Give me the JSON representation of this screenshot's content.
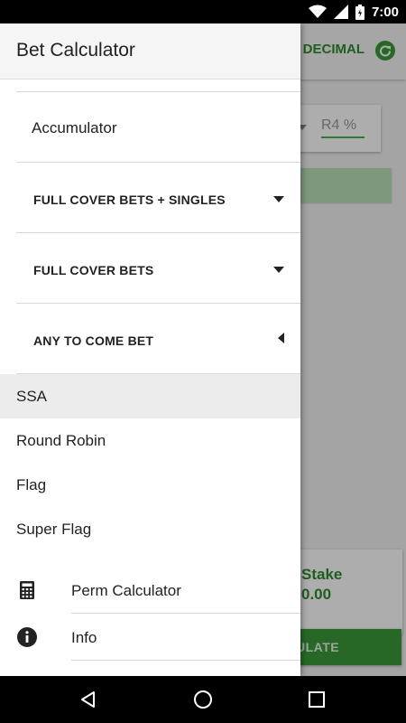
{
  "status_bar": {
    "time": "7:00"
  },
  "background_app": {
    "odds_format": "DECIMAL",
    "rule4_placeholder": "R4 %",
    "total_stake_label": "Stake",
    "total_stake_value": "0.00",
    "calculate_label": "ULATE",
    "accent_color": "#3a9a3a"
  },
  "drawer": {
    "title": "Bet Calculator",
    "accumulator": "Accumulator",
    "groups": [
      {
        "label": "FULL COVER BETS + SINGLES",
        "state": "collapsed"
      },
      {
        "label": "FULL COVER BETS",
        "state": "collapsed"
      },
      {
        "label": "ANY TO COME BET",
        "state": "expanded"
      }
    ],
    "items": [
      {
        "label": "SSA",
        "selected": true
      },
      {
        "label": "Round Robin",
        "selected": false
      },
      {
        "label": "Flag",
        "selected": false
      },
      {
        "label": "Super Flag",
        "selected": false
      }
    ],
    "icon_items": [
      {
        "label": "Perm Calculator",
        "icon": "calculator-icon"
      },
      {
        "label": "Info",
        "icon": "info-icon"
      }
    ]
  },
  "nav_bar": {
    "back": "back-icon",
    "home": "home-icon",
    "recents": "recents-icon"
  }
}
